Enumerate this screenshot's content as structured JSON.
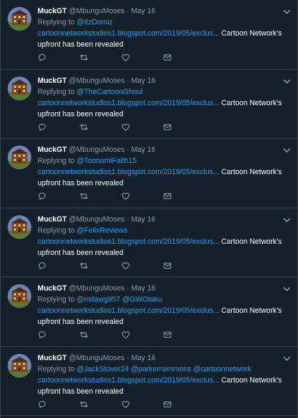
{
  "tweets": [
    {
      "name": "MuckGT",
      "handle": "@MbunguMoses",
      "dot": "·",
      "date": "May 16",
      "reply_prefix": "Replying to",
      "mentions": [
        "@ItzDomiz"
      ],
      "link": "cartoonnetworkstudios1.blogspot.com/2019/05/exclus...",
      "text": "Cartoon Network's upfront has been revealed"
    },
    {
      "name": "MuckGT",
      "handle": "@MbunguMoses",
      "dot": "·",
      "date": "May 16",
      "reply_prefix": "Replying to",
      "mentions": [
        "@TheCartoonGhoul"
      ],
      "link": "cartoonnetworkstudios1.blogspot.com/2019/05/exclus...",
      "text": "Cartoon Network's upfront has been revealed"
    },
    {
      "name": "MuckGT",
      "handle": "@MbunguMoses",
      "dot": "·",
      "date": "May 16",
      "reply_prefix": "Replying to",
      "mentions": [
        "@ToonamiFaith15"
      ],
      "link": "cartoonnetworkstudios1.blogspot.com/2019/05/exclus...",
      "text": "Cartoon Network's upfront has been revealed"
    },
    {
      "name": "MuckGT",
      "handle": "@MbunguMoses",
      "dot": "·",
      "date": "May 16",
      "reply_prefix": "Replying to",
      "mentions": [
        "@FelixReviews"
      ],
      "link": "cartoonnetworkstudios1.blogspot.com/2019/05/exclus...",
      "text": "Cartoon Network's upfront has been revealed"
    },
    {
      "name": "MuckGT",
      "handle": "@MbunguMoses",
      "dot": "·",
      "date": "May 16",
      "reply_prefix": "Replying to",
      "mentions": [
        "@mdawg957",
        "@GWOtaku"
      ],
      "link": "cartoonnetworkstudios1.blogspot.com/2019/05/exclus...",
      "text": "Cartoon Network's upfront has been revealed"
    },
    {
      "name": "MuckGT",
      "handle": "@MbunguMoses",
      "dot": "·",
      "date": "May 16",
      "reply_prefix": "Replying to",
      "mentions": [
        "@JackStover24",
        "@parkerrsimmons",
        "@cartoonnetwork"
      ],
      "link": "cartoonnetworkstudios1.blogspot.com/2019/05/exclus...",
      "text": "Cartoon Network's upfront has been revealed"
    }
  ],
  "icons": {
    "reply": "reply-icon",
    "retweet": "retweet-icon",
    "like": "like-icon",
    "dm": "message-icon",
    "more": "chevron-down-icon",
    "avatar": "avatar-building"
  },
  "colors": {
    "background": "#15202b",
    "divider": "#38444d",
    "secondary_text": "#8899a6",
    "link": "#1da1f2",
    "primary_text": "#ffffff"
  }
}
